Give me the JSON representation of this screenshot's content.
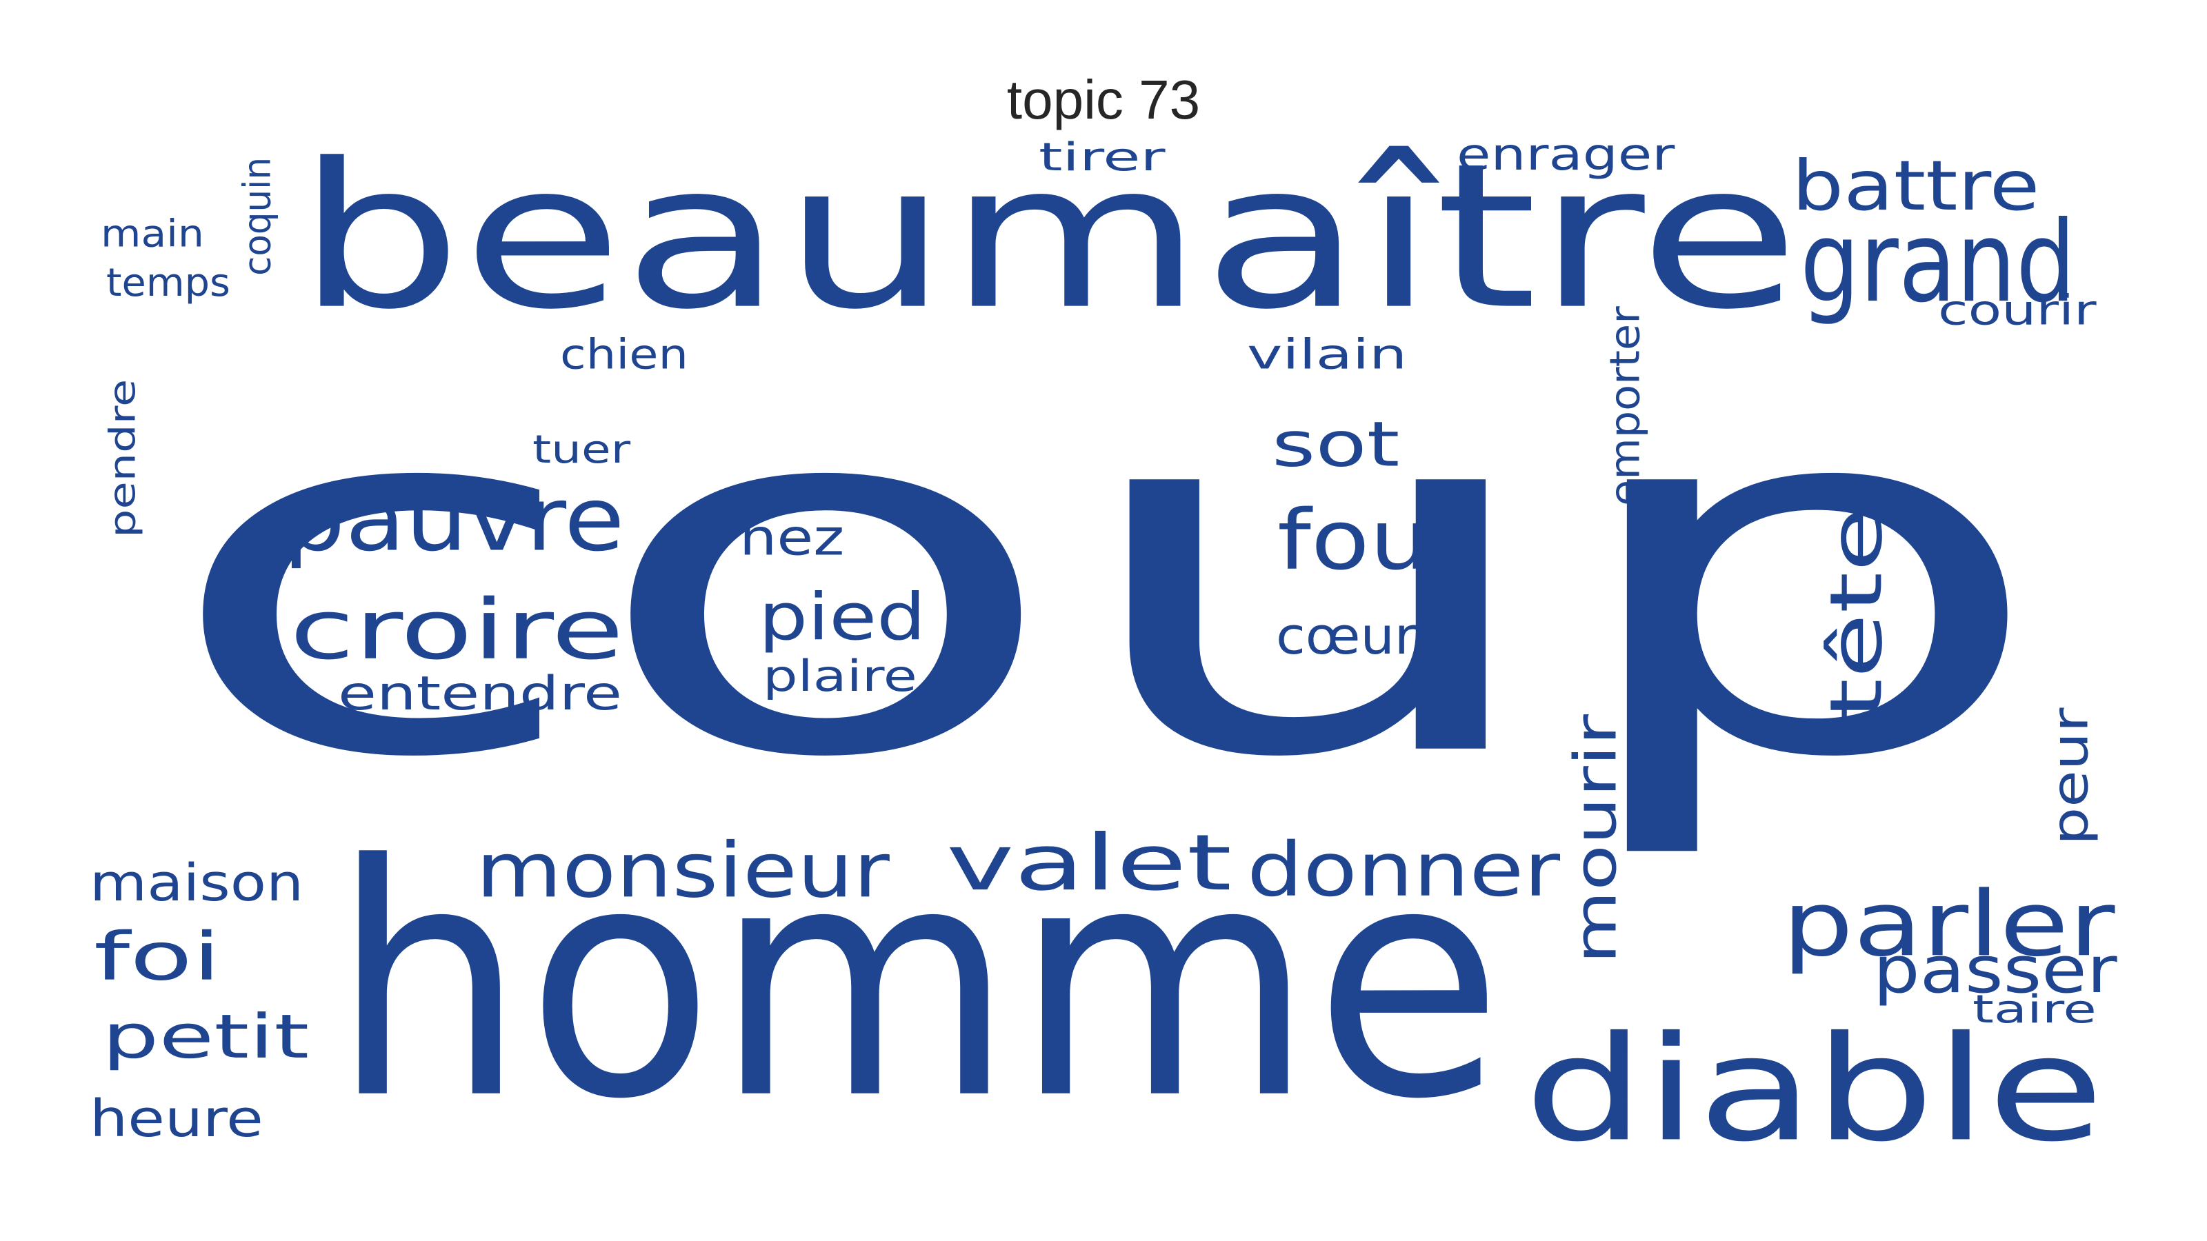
{
  "title": "topic 73",
  "color": "#1f4591",
  "words": [
    {
      "id": "coup",
      "text": "coup",
      "vertical": false
    },
    {
      "id": "homme",
      "text": "homme",
      "vertical": false
    },
    {
      "id": "beaumaitre",
      "text": "beaumaître",
      "vertical": false
    },
    {
      "id": "diable",
      "text": "diable",
      "vertical": false
    },
    {
      "id": "grand",
      "text": "grand",
      "vertical": false
    },
    {
      "id": "monsieur",
      "text": "monsieur",
      "vertical": false
    },
    {
      "id": "valet",
      "text": "valet",
      "vertical": false
    },
    {
      "id": "donner",
      "text": "donner",
      "vertical": false
    },
    {
      "id": "parler",
      "text": "parler",
      "vertical": false
    },
    {
      "id": "pauvre",
      "text": "pauvre",
      "vertical": false
    },
    {
      "id": "croire",
      "text": "croire",
      "vertical": false
    },
    {
      "id": "fou",
      "text": "fou",
      "vertical": false
    },
    {
      "id": "tete",
      "text": "tête",
      "vertical": true
    },
    {
      "id": "battre",
      "text": "battre",
      "vertical": false
    },
    {
      "id": "mourir",
      "text": "mourir",
      "vertical": true
    },
    {
      "id": "pied",
      "text": "pied",
      "vertical": false
    },
    {
      "id": "passer",
      "text": "passer",
      "vertical": false
    },
    {
      "id": "foi",
      "text": "foi",
      "vertical": false
    },
    {
      "id": "sot",
      "text": "sot",
      "vertical": false
    },
    {
      "id": "petit",
      "text": "petit",
      "vertical": false
    },
    {
      "id": "entendre",
      "text": "entendre",
      "vertical": false
    },
    {
      "id": "maison",
      "text": "maison",
      "vertical": false
    },
    {
      "id": "coeur",
      "text": "cœur",
      "vertical": false
    },
    {
      "id": "nez",
      "text": "nez",
      "vertical": false
    },
    {
      "id": "heure",
      "text": "heure",
      "vertical": false
    },
    {
      "id": "peur",
      "text": "peur",
      "vertical": true
    },
    {
      "id": "enrager",
      "text": "enrager",
      "vertical": false
    },
    {
      "id": "tirer",
      "text": "tirer",
      "vertical": false
    },
    {
      "id": "chien",
      "text": "chien",
      "vertical": false
    },
    {
      "id": "vilain",
      "text": "vilain",
      "vertical": false
    },
    {
      "id": "plaire",
      "text": "plaire",
      "vertical": false
    },
    {
      "id": "tuer",
      "text": "tuer",
      "vertical": false
    },
    {
      "id": "courir",
      "text": "courir",
      "vertical": false
    },
    {
      "id": "coquin",
      "text": "coquin",
      "vertical": true
    },
    {
      "id": "temps",
      "text": "temps",
      "vertical": false
    },
    {
      "id": "main",
      "text": "main",
      "vertical": false
    },
    {
      "id": "emporter",
      "text": "emporter",
      "vertical": true
    },
    {
      "id": "pendre",
      "text": "pendre",
      "vertical": true
    },
    {
      "id": "taire",
      "text": "taire",
      "vertical": false
    }
  ]
}
